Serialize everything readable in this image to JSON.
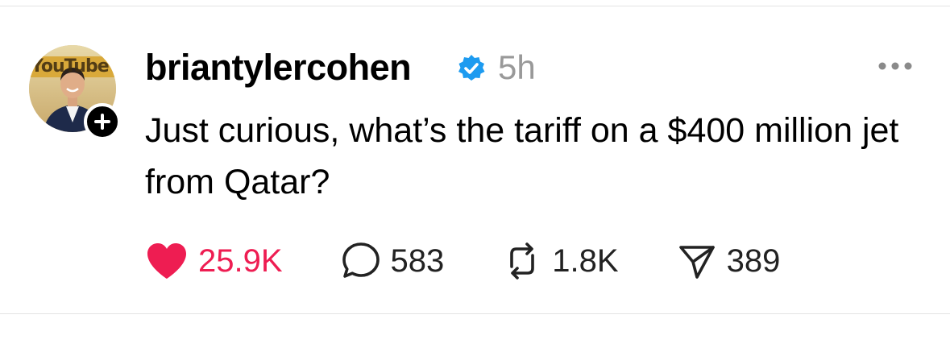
{
  "post": {
    "username": "briantylercohen",
    "timestamp": "5h",
    "verified": true,
    "text": "Just curious, what’s the tariff on a $400 million jet from Qatar?",
    "avatar_overlay_text": "YouTube",
    "actions": {
      "like_count": "25.9K",
      "reply_count": "583",
      "repost_count": "1.8K",
      "share_count": "389"
    }
  },
  "icons": {
    "like": "heart-icon",
    "reply": "speech-bubble-icon",
    "repost": "repost-arrows-icon",
    "share": "paper-plane-icon",
    "more": "ellipsis-icon",
    "follow": "plus-icon",
    "verified": "verified-badge-icon"
  },
  "colors": {
    "like": "#ee1d52",
    "verified": "#1d9bf0",
    "timestamp": "#999999",
    "text": "#000000"
  }
}
